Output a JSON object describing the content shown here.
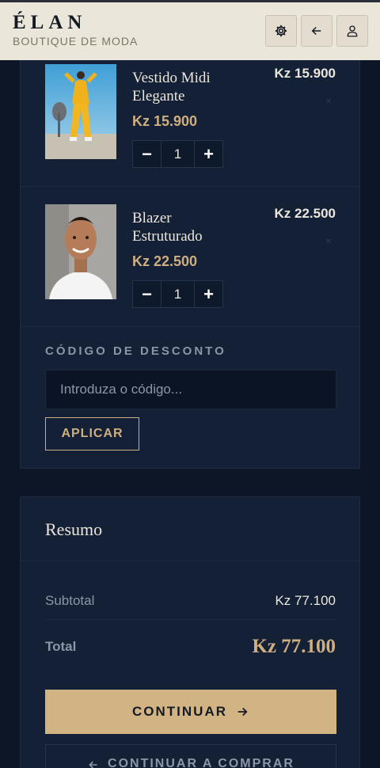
{
  "header": {
    "logo": "ÉLAN",
    "subtitle": "BOUTIQUE DE MODA",
    "icons": [
      "settings-icon",
      "back-arrow-icon",
      "user-icon"
    ]
  },
  "cart": {
    "items": [
      {
        "name": "Vestido Midi Elegante",
        "price": "Kz 15.900",
        "total": "Kz 15.900",
        "quantity": "1",
        "remove": "×"
      },
      {
        "name": "Blazer Estruturado",
        "price": "Kz 22.500",
        "total": "Kz 22.500",
        "quantity": "1",
        "remove": "×"
      }
    ],
    "stepper": {
      "minus": "−",
      "plus": "+"
    },
    "discount": {
      "label": "CÓDIGO DE DESCONTO",
      "placeholder": "Introduza o código...",
      "apply_label": "APLICAR"
    }
  },
  "summary": {
    "title": "Resumo",
    "subtotal_label": "Subtotal",
    "subtotal_value": "Kz 77.100",
    "total_label": "Total",
    "total_value": "Kz 77.100",
    "continue_label": "CONTINUAR",
    "back_label": "CONTINUAR A COMPRAR"
  },
  "colors": {
    "accent": "#d2b383",
    "background": "#0c1626",
    "card": "#132036",
    "header": "#ebe6da"
  }
}
